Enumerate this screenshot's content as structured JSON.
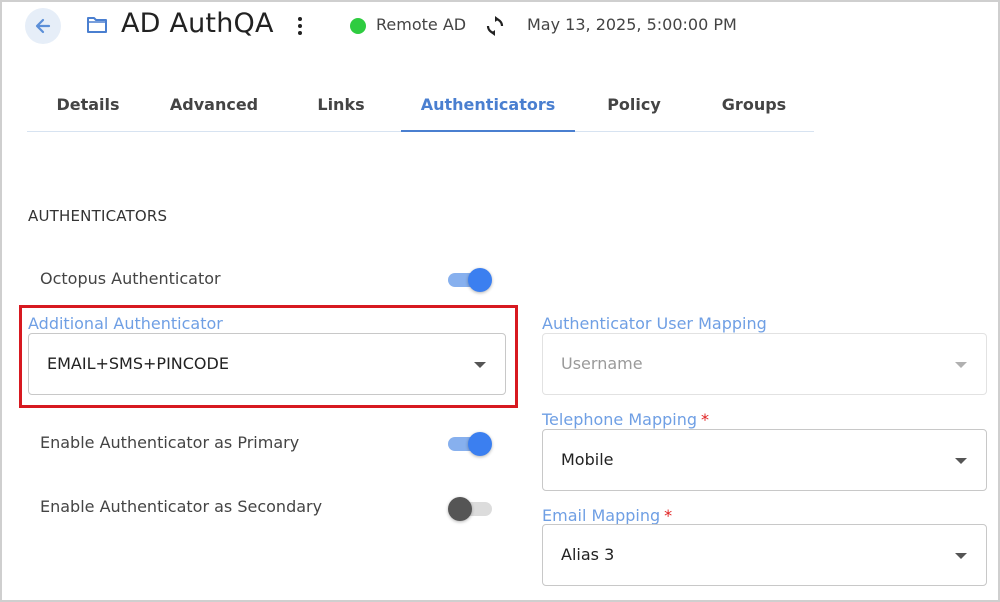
{
  "header": {
    "title": "AD AuthQA",
    "status_text": "Remote AD",
    "status_color": "#2ecc40",
    "timestamp": "May 13, 2025, 5:00:00 PM",
    "icons": [
      "back-arrow-icon",
      "folder-icon",
      "more-vert-icon",
      "sync-icon"
    ]
  },
  "tabs": [
    {
      "label": "Details"
    },
    {
      "label": "Advanced"
    },
    {
      "label": "Links"
    },
    {
      "label": "Authenticators",
      "active": true
    },
    {
      "label": "Policy"
    },
    {
      "label": "Groups"
    }
  ],
  "section": {
    "title": "AUTHENTICATORS"
  },
  "octopus_authenticator": {
    "label": "Octopus Authenticator",
    "enabled": true
  },
  "additional_authenticator": {
    "label": "Additional Authenticator",
    "value": "EMAIL+SMS+PINCODE"
  },
  "user_mapping": {
    "label": "Authenticator User Mapping",
    "value": "Username",
    "disabled": true
  },
  "telephone_mapping": {
    "label": "Telephone Mapping",
    "required_mark": "*",
    "value": "Mobile"
  },
  "email_mapping": {
    "label": "Email Mapping",
    "required_mark": "*",
    "value": "Alias 3"
  },
  "primary": {
    "label": "Enable Authenticator as Primary",
    "enabled": true
  },
  "secondary": {
    "label": "Enable Authenticator as Secondary",
    "enabled": false
  },
  "colors": {
    "accent": "#4a7fd0",
    "toggle_on": "#3b7ff0",
    "highlight": "#d71920",
    "required": "#e02020"
  }
}
